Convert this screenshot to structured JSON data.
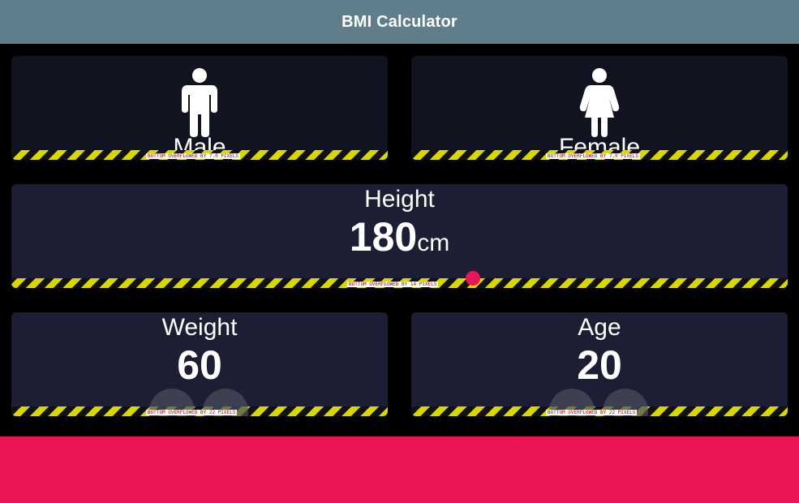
{
  "app": {
    "title": "BMI Calculator"
  },
  "gender": {
    "male": {
      "label": "Male",
      "icon": "male-figure-icon",
      "overflow": "BOTTOM OVERFLOWED BY 7.0 PIXELS"
    },
    "female": {
      "label": "Female",
      "icon": "female-figure-icon",
      "overflow": "BOTTOM OVERFLOWED BY 7.0 PIXELS"
    }
  },
  "height": {
    "label": "Height",
    "value": "180",
    "unit": "cm",
    "overflow": "BOTTOM OVERFLOWED BY 14 PIXELS"
  },
  "weight": {
    "label": "Weight",
    "value": "60",
    "overflow": "BOTTOM OVERFLOWED BY 22 PIXELS"
  },
  "age": {
    "label": "Age",
    "value": "20",
    "overflow": "BOTTOM OVERFLOWED BY 22 PIXELS"
  },
  "colors": {
    "appbar": "#607d8b",
    "card_inactive": "#111320",
    "card_active": "#1d1e33",
    "accent": "#eb1555",
    "round_button": "#4c4f5e"
  }
}
